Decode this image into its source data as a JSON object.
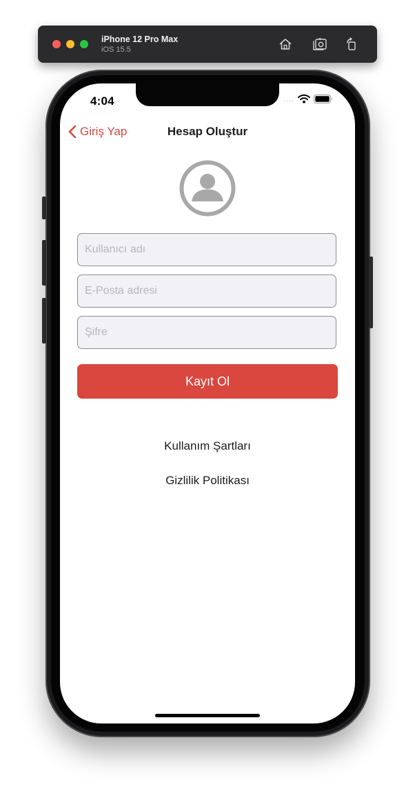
{
  "simulator": {
    "device_name": "iPhone 12 Pro Max",
    "os_version": "iOS 15.5",
    "icons": [
      "home-icon",
      "screenshot-icon",
      "rotate-icon"
    ]
  },
  "status_bar": {
    "time": "4:04",
    "icons": [
      "signal-dots-icon",
      "wifi-icon",
      "battery-icon"
    ]
  },
  "nav": {
    "back_label": "Giriş Yap",
    "title": "Hesap Oluştur"
  },
  "form": {
    "username_placeholder": "Kullanıcı adı",
    "email_placeholder": "E-Posta adresi",
    "password_placeholder": "Şifre",
    "submit_label": "Kayıt Ol"
  },
  "links": {
    "terms": "Kullanım Şartları",
    "privacy": "Gizlilik Politikası"
  },
  "colors": {
    "accent": "#d9473f",
    "field_bg": "#f2f1f6",
    "avatar_gray": "#a8a8a8"
  }
}
